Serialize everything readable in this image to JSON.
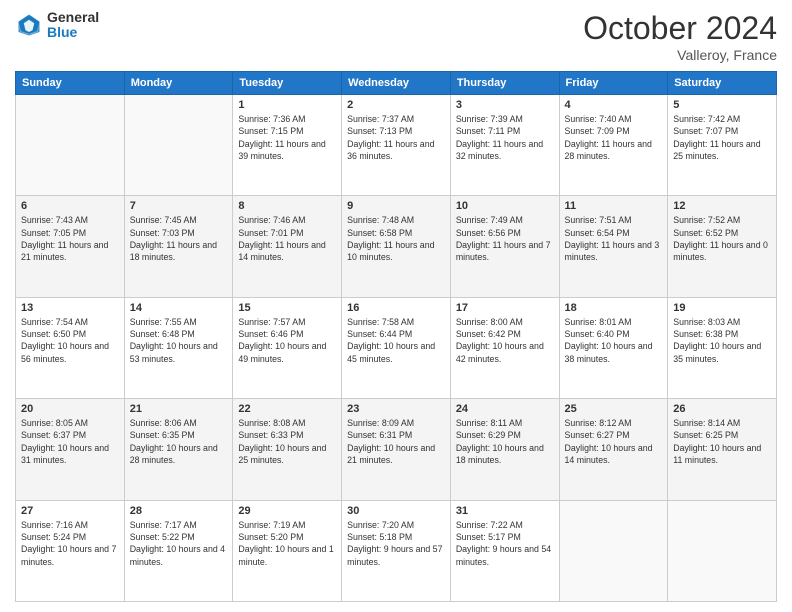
{
  "header": {
    "logo_general": "General",
    "logo_blue": "Blue",
    "month": "October 2024",
    "location": "Valleroy, France"
  },
  "days_of_week": [
    "Sunday",
    "Monday",
    "Tuesday",
    "Wednesday",
    "Thursday",
    "Friday",
    "Saturday"
  ],
  "weeks": [
    [
      {
        "num": "",
        "detail": ""
      },
      {
        "num": "",
        "detail": ""
      },
      {
        "num": "1",
        "detail": "Sunrise: 7:36 AM\nSunset: 7:15 PM\nDaylight: 11 hours and 39 minutes."
      },
      {
        "num": "2",
        "detail": "Sunrise: 7:37 AM\nSunset: 7:13 PM\nDaylight: 11 hours and 36 minutes."
      },
      {
        "num": "3",
        "detail": "Sunrise: 7:39 AM\nSunset: 7:11 PM\nDaylight: 11 hours and 32 minutes."
      },
      {
        "num": "4",
        "detail": "Sunrise: 7:40 AM\nSunset: 7:09 PM\nDaylight: 11 hours and 28 minutes."
      },
      {
        "num": "5",
        "detail": "Sunrise: 7:42 AM\nSunset: 7:07 PM\nDaylight: 11 hours and 25 minutes."
      }
    ],
    [
      {
        "num": "6",
        "detail": "Sunrise: 7:43 AM\nSunset: 7:05 PM\nDaylight: 11 hours and 21 minutes."
      },
      {
        "num": "7",
        "detail": "Sunrise: 7:45 AM\nSunset: 7:03 PM\nDaylight: 11 hours and 18 minutes."
      },
      {
        "num": "8",
        "detail": "Sunrise: 7:46 AM\nSunset: 7:01 PM\nDaylight: 11 hours and 14 minutes."
      },
      {
        "num": "9",
        "detail": "Sunrise: 7:48 AM\nSunset: 6:58 PM\nDaylight: 11 hours and 10 minutes."
      },
      {
        "num": "10",
        "detail": "Sunrise: 7:49 AM\nSunset: 6:56 PM\nDaylight: 11 hours and 7 minutes."
      },
      {
        "num": "11",
        "detail": "Sunrise: 7:51 AM\nSunset: 6:54 PM\nDaylight: 11 hours and 3 minutes."
      },
      {
        "num": "12",
        "detail": "Sunrise: 7:52 AM\nSunset: 6:52 PM\nDaylight: 11 hours and 0 minutes."
      }
    ],
    [
      {
        "num": "13",
        "detail": "Sunrise: 7:54 AM\nSunset: 6:50 PM\nDaylight: 10 hours and 56 minutes."
      },
      {
        "num": "14",
        "detail": "Sunrise: 7:55 AM\nSunset: 6:48 PM\nDaylight: 10 hours and 53 minutes."
      },
      {
        "num": "15",
        "detail": "Sunrise: 7:57 AM\nSunset: 6:46 PM\nDaylight: 10 hours and 49 minutes."
      },
      {
        "num": "16",
        "detail": "Sunrise: 7:58 AM\nSunset: 6:44 PM\nDaylight: 10 hours and 45 minutes."
      },
      {
        "num": "17",
        "detail": "Sunrise: 8:00 AM\nSunset: 6:42 PM\nDaylight: 10 hours and 42 minutes."
      },
      {
        "num": "18",
        "detail": "Sunrise: 8:01 AM\nSunset: 6:40 PM\nDaylight: 10 hours and 38 minutes."
      },
      {
        "num": "19",
        "detail": "Sunrise: 8:03 AM\nSunset: 6:38 PM\nDaylight: 10 hours and 35 minutes."
      }
    ],
    [
      {
        "num": "20",
        "detail": "Sunrise: 8:05 AM\nSunset: 6:37 PM\nDaylight: 10 hours and 31 minutes."
      },
      {
        "num": "21",
        "detail": "Sunrise: 8:06 AM\nSunset: 6:35 PM\nDaylight: 10 hours and 28 minutes."
      },
      {
        "num": "22",
        "detail": "Sunrise: 8:08 AM\nSunset: 6:33 PM\nDaylight: 10 hours and 25 minutes."
      },
      {
        "num": "23",
        "detail": "Sunrise: 8:09 AM\nSunset: 6:31 PM\nDaylight: 10 hours and 21 minutes."
      },
      {
        "num": "24",
        "detail": "Sunrise: 8:11 AM\nSunset: 6:29 PM\nDaylight: 10 hours and 18 minutes."
      },
      {
        "num": "25",
        "detail": "Sunrise: 8:12 AM\nSunset: 6:27 PM\nDaylight: 10 hours and 14 minutes."
      },
      {
        "num": "26",
        "detail": "Sunrise: 8:14 AM\nSunset: 6:25 PM\nDaylight: 10 hours and 11 minutes."
      }
    ],
    [
      {
        "num": "27",
        "detail": "Sunrise: 7:16 AM\nSunset: 5:24 PM\nDaylight: 10 hours and 7 minutes."
      },
      {
        "num": "28",
        "detail": "Sunrise: 7:17 AM\nSunset: 5:22 PM\nDaylight: 10 hours and 4 minutes."
      },
      {
        "num": "29",
        "detail": "Sunrise: 7:19 AM\nSunset: 5:20 PM\nDaylight: 10 hours and 1 minute."
      },
      {
        "num": "30",
        "detail": "Sunrise: 7:20 AM\nSunset: 5:18 PM\nDaylight: 9 hours and 57 minutes."
      },
      {
        "num": "31",
        "detail": "Sunrise: 7:22 AM\nSunset: 5:17 PM\nDaylight: 9 hours and 54 minutes."
      },
      {
        "num": "",
        "detail": ""
      },
      {
        "num": "",
        "detail": ""
      }
    ]
  ]
}
